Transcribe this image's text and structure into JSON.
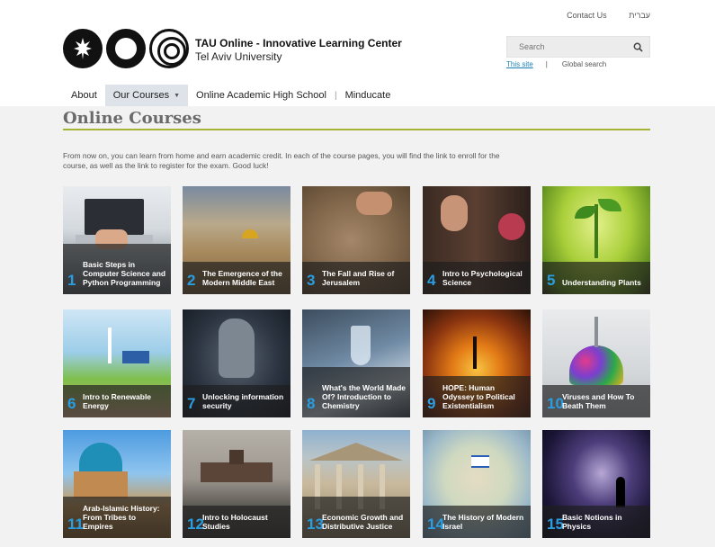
{
  "header": {
    "contact_us": "Contact Us",
    "hebrew": "עברית",
    "title": "TAU Online - Innovative Learning Center",
    "subtitle": "Tel Aviv University"
  },
  "search": {
    "placeholder": "Search",
    "this_site": "This site",
    "separator": "|",
    "global": "Global search"
  },
  "nav": {
    "items": [
      {
        "label": "About"
      },
      {
        "label": "Our Courses"
      },
      {
        "label": "Online Academic High School"
      },
      {
        "label": "Minducate"
      }
    ],
    "separator": "|"
  },
  "page": {
    "title": "Online Courses",
    "intro": "From now on, you can learn from home and earn academic credit. In each of the course pages, you will find the link to enroll for the course, as well as the link to register for the exam. Good luck!"
  },
  "courses": [
    {
      "num": "1",
      "label": "Basic Steps in Computer Science and Python Programming"
    },
    {
      "num": "2",
      "label": "The Emergence of the Modern Middle East"
    },
    {
      "num": "3",
      "label": "The Fall and Rise of Jerusalem"
    },
    {
      "num": "4",
      "label": "Intro to Psychological Science"
    },
    {
      "num": "5",
      "label": "Understanding Plants"
    },
    {
      "num": "6",
      "label": "Intro to Renewable Energy"
    },
    {
      "num": "7",
      "label": "Unlocking information security"
    },
    {
      "num": "8",
      "label": "What's the World Made Of? Introduction to Chemistry"
    },
    {
      "num": "9",
      "label": "HOPE: Human Odyssey to Political Existentialism"
    },
    {
      "num": "10",
      "label": "Viruses and How To Beath Them"
    },
    {
      "num": "11",
      "label": "Arab-Islamic History: From Tribes to Empires"
    },
    {
      "num": "12",
      "label": "Intro to Holocaust Studies"
    },
    {
      "num": "13",
      "label": "Economic Growth and Distributive Justice"
    },
    {
      "num": "14",
      "label": "The History of Modern Israel"
    },
    {
      "num": "15",
      "label": "Basic Notions in Physics"
    }
  ],
  "colors": {
    "accent_rule": "#a5b337",
    "number_blue": "#2a9de0",
    "link_blue": "#1a7fb5"
  }
}
